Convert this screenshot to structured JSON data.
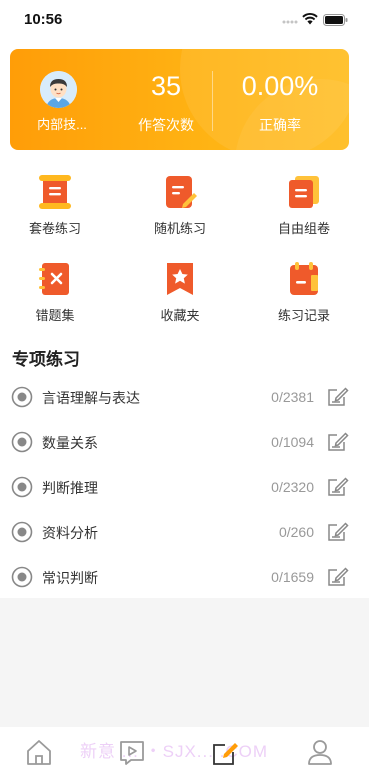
{
  "status_bar": {
    "time": "10:56"
  },
  "profile": {
    "user_name": "内部技...",
    "answer_count": "35",
    "answer_count_label": "作答次数",
    "accuracy": "0.00%",
    "accuracy_label": "正确率"
  },
  "features": [
    {
      "label": "套卷练习",
      "icon": "paper-set-icon"
    },
    {
      "label": "随机练习",
      "icon": "random-practice-icon"
    },
    {
      "label": "自由组卷",
      "icon": "custom-paper-icon"
    },
    {
      "label": "错题集",
      "icon": "wrong-questions-icon"
    },
    {
      "label": "收藏夹",
      "icon": "favorites-icon"
    },
    {
      "label": "练习记录",
      "icon": "practice-record-icon"
    }
  ],
  "special_practice": {
    "title": "专项练习",
    "items": [
      {
        "label": "言语理解与表达",
        "progress": "0/2381"
      },
      {
        "label": "数量关系",
        "progress": "0/1094"
      },
      {
        "label": "判断推理",
        "progress": "0/2320"
      },
      {
        "label": "资料分析",
        "progress": "0/260"
      },
      {
        "label": "常识判断",
        "progress": "0/1659"
      }
    ]
  },
  "tab_bar": {
    "tabs": [
      "home-icon",
      "video-icon",
      "practice-icon",
      "profile-icon"
    ],
    "active_tab": "practice-icon",
    "watermark": "新意 ... ・SJX... .COM"
  },
  "colors": {
    "accent": "#ff9d08",
    "icon_red": "#ef5a2b",
    "icon_orange": "#ff8a1f",
    "icon_yellow": "#ffc23a"
  }
}
